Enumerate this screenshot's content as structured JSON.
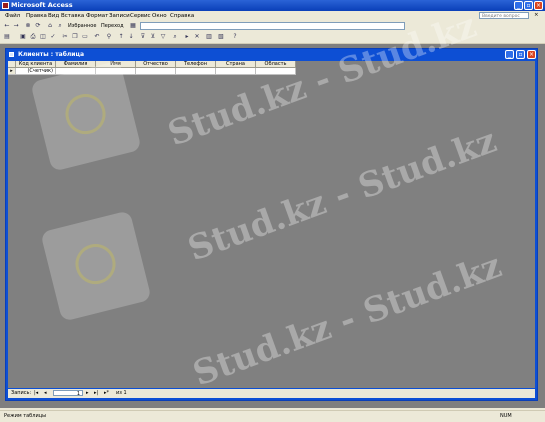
{
  "app": {
    "title": "Microsoft Access"
  },
  "menu": [
    "Файл",
    "Правка",
    "Вид",
    "Вставка",
    "Формат",
    "Записи",
    "Сервис",
    "Окно",
    "Справка"
  ],
  "help": {
    "placeholder": "Введите вопрос"
  },
  "toolbar2": {
    "favorites_label": "Избранное",
    "goto_label": "Переход"
  },
  "table_window": {
    "title": "Клиенты : таблица"
  },
  "grid": {
    "columns": [
      "Код клиента",
      "Фамилия",
      "Имя",
      "Отчество",
      "Телефон",
      "Страна",
      "Область"
    ],
    "new_row_value": "(Счетчик)"
  },
  "nav": {
    "label": "Запись:",
    "current": "1",
    "of_label": "из 1"
  },
  "status": {
    "left": "Режим таблицы",
    "num": "NUM"
  },
  "watermark": "Stud.kz - Stud.kz"
}
